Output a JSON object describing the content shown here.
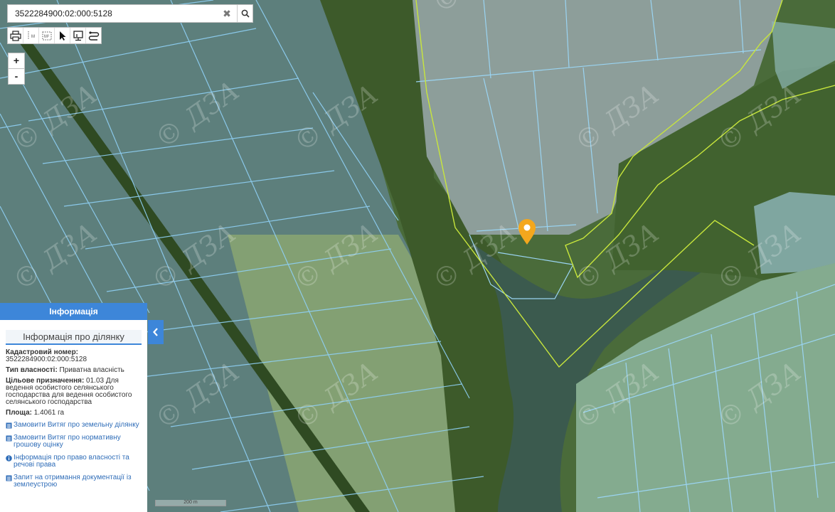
{
  "search": {
    "value": "3522284900:02:000:5128",
    "clear_icon": "close-icon",
    "search_icon": "search-icon"
  },
  "toolbar": {
    "tools": [
      "print-icon",
      "measure-line-icon",
      "measure-area-icon",
      "pointer-icon",
      "identify-icon",
      "route-icon"
    ]
  },
  "zoom": {
    "in_label": "+",
    "out_label": "-"
  },
  "map": {
    "watermark": "© ДЗА",
    "scale_label": "200 m",
    "marker_color": "#f4a71d",
    "parcel_stroke": "#7ec8f0",
    "boundary_stroke": "#c8e63c"
  },
  "panel": {
    "header": "Інформація",
    "subtitle": "Інформація про ділянку",
    "cadastral_label": "Кадастровий номер:",
    "cadastral_value": "3522284900:02:000:5128",
    "ownership_label": "Тип власності:",
    "ownership_value": " Приватна власність",
    "purpose_label": "Цільове призначення:",
    "purpose_value": " 01.03 Для ведення особистого селянського господарства для ведення особистого селянського господарства",
    "area_label": "Площа:",
    "area_value": " 1.4061 га",
    "links": [
      {
        "text": "Замовити Витяг про земельну ділянку",
        "icon": "document-icon"
      },
      {
        "text": "Замовити Витяг про нормативну грошову оцінку",
        "icon": "document-icon"
      },
      {
        "text": "Інформація про право власності та речові права",
        "icon": "info-icon"
      },
      {
        "text": "Запит на отримання документації із землеустрою",
        "icon": "document-icon"
      }
    ]
  }
}
